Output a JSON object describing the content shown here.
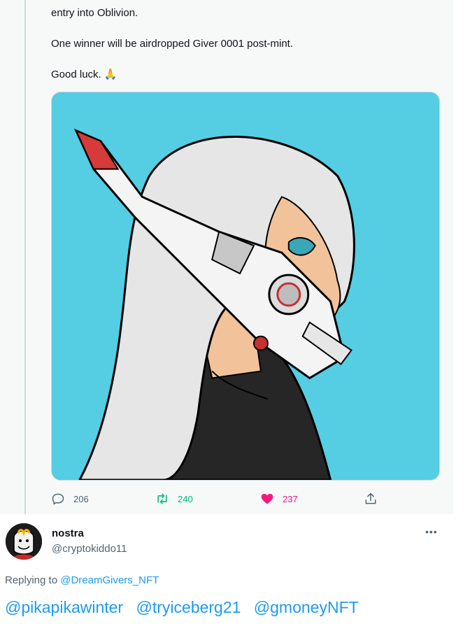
{
  "tweet": {
    "lines": [
      "entry into Oblivion.",
      "One winner will be airdropped Giver 0001 post-mint.",
      "Good luck."
    ],
    "emoji": "🙏",
    "actions": {
      "replies": "206",
      "retweets": "240",
      "likes": "237"
    },
    "colors": {
      "retweet": "#00ba7c",
      "like": "#f91880",
      "muted": "#536471"
    }
  },
  "reply": {
    "name": "nostra",
    "handle": "@cryptokiddo11",
    "replying_prefix": "Replying to ",
    "replying_to": "@DreamGivers_NFT",
    "mentions": [
      "@pikapikawinter",
      "@tryiceberg21",
      "@gmoneyNFT"
    ],
    "more_icon": "more-icon"
  }
}
